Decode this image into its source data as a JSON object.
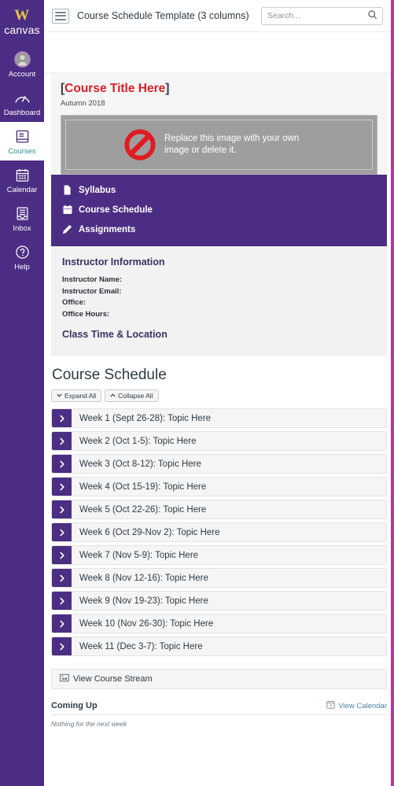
{
  "colors": {
    "brand_purple": "#4b2e83",
    "accent_magenta": "#b0399e",
    "logo_gold": "#e8c547",
    "active_teal": "#2d8f9a",
    "title_red": "#d62027",
    "link_blue": "#4b7fa8"
  },
  "global_nav": {
    "brand_mark": "W",
    "brand_name": "canvas",
    "items": [
      {
        "label": "Account",
        "icon": "user-avatar-icon",
        "active": false
      },
      {
        "label": "Dashboard",
        "icon": "dashboard-speedometer-icon",
        "active": false
      },
      {
        "label": "Courses",
        "icon": "courses-book-icon",
        "active": true
      },
      {
        "label": "Calendar",
        "icon": "calendar-icon",
        "active": false
      },
      {
        "label": "Inbox",
        "icon": "inbox-tray-icon",
        "active": false
      },
      {
        "label": "Help",
        "icon": "help-question-icon",
        "active": false
      }
    ]
  },
  "topbar": {
    "menu_icon": "hamburger-menu-icon",
    "title": "Course Schedule Template (3 columns)",
    "search_placeholder": "Search...",
    "search_value": "",
    "search_icon": "search-magnifier-icon"
  },
  "course_header": {
    "title_open_bracket": "[",
    "title_text": "Course Title Here",
    "title_close_bracket": "]",
    "term": "Autumn 2018",
    "image_placeholder_text": "Replace this image with your own image or delete it.",
    "image_placeholder_icon": "no-entry-prohibition-icon"
  },
  "course_nav": [
    {
      "label": "Syllabus",
      "icon": "document-page-icon"
    },
    {
      "label": "Course Schedule",
      "icon": "calendar-icon"
    },
    {
      "label": "Assignments",
      "icon": "pencil-edit-icon"
    }
  ],
  "instructor": {
    "heading": "Instructor Information",
    "fields": [
      "Instructor Name:",
      "Instructor Email:",
      "Office:",
      "Office Hours:"
    ],
    "subheading": "Class Time & Location"
  },
  "schedule": {
    "heading": "Course Schedule",
    "expand_all_label": "Expand All",
    "expand_all_icon": "chevron-down-icon",
    "collapse_all_label": "Collapse All",
    "collapse_all_icon": "chevron-up-icon",
    "row_toggle_icon": "chevron-right-icon",
    "weeks": [
      "Week 1 (Sept 26-28): Topic Here",
      "Week 2 (Oct 1-5): Topic Here",
      "Week 3 (Oct 8-12): Topic Here",
      "Week 4 (Oct 15-19): Topic Here",
      "Week 5 (Oct 22-26): Topic Here",
      "Week 6 (Oct 29-Nov 2): Topic Here",
      "Week 7 (Nov 5-9): Topic Here",
      "Week 8 (Nov 12-16): Topic Here",
      "Week 9 (Nov 19-23): Topic Here",
      "Week 10 (Nov 26-30): Topic Here",
      "Week 11 (Dec 3-7): Topic Here"
    ]
  },
  "footer": {
    "stream_label": "View Course Stream",
    "stream_icon": "course-stream-icon",
    "coming_up_title": "Coming Up",
    "view_calendar_label": "View Calendar",
    "view_calendar_icon": "calendar-icon",
    "coming_up_empty": "Nothing for the next week"
  }
}
